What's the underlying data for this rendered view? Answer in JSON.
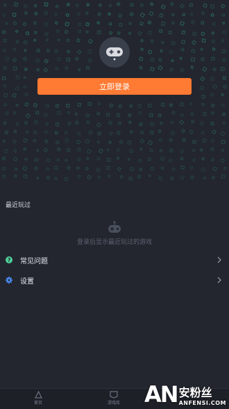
{
  "header": {
    "avatar_icon": "gamepad-icon",
    "login_button_label": "立即登录"
  },
  "recent": {
    "title": "最近玩过",
    "empty_icon": "gamepad-icon",
    "empty_text": "登录后显示最近玩过的游戏"
  },
  "menu": [
    {
      "label": "常见问题",
      "icon": "help-circle-icon",
      "icon_color": "#4fd19a"
    },
    {
      "label": "设置",
      "icon": "gear-icon",
      "icon_color": "#4b8bf5"
    }
  ],
  "tabbar": {
    "items": [
      {
        "label": "首页",
        "icon": "home-icon"
      },
      {
        "label": "游戏库",
        "icon": "library-icon"
      }
    ]
  },
  "watermark": {
    "logo_text": "AN",
    "cn_text": "安粉丝",
    "en_text": "ANFENSI.COM"
  },
  "colors": {
    "background": "#23262f",
    "accent": "#ff7a33",
    "pattern": "#2e8a6e"
  }
}
